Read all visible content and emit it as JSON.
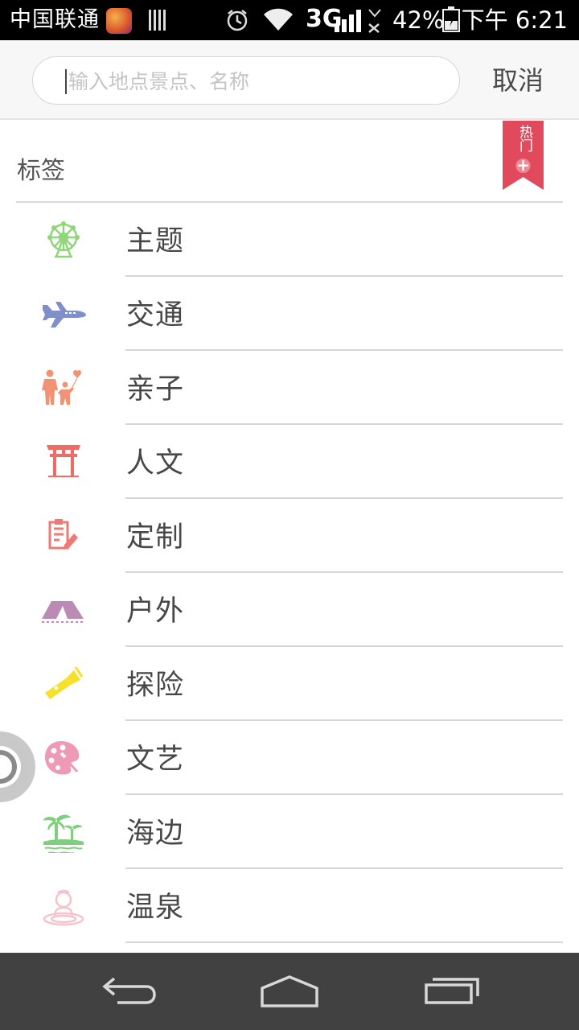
{
  "status_bar": {
    "carrier": "中国联通",
    "network": "3G",
    "battery_percent": "42%",
    "time": "下午 6:21"
  },
  "search": {
    "placeholder": "输入地点景点、名称",
    "value": "",
    "cancel_label": "取消"
  },
  "tags": {
    "title": "标签",
    "hot_ribbon": {
      "text": "热门",
      "plus": "+"
    },
    "items": [
      {
        "label": "主题",
        "icon": "ferris-wheel-icon",
        "color": "#8fd67a"
      },
      {
        "label": "交通",
        "icon": "airplane-icon",
        "color": "#7f8fc9"
      },
      {
        "label": "亲子",
        "icon": "parent-child-icon",
        "color": "#f19274"
      },
      {
        "label": "人文",
        "icon": "torii-gate-icon",
        "color": "#ee6b66"
      },
      {
        "label": "定制",
        "icon": "clipboard-edit-icon",
        "color": "#ef7a74"
      },
      {
        "label": "户外",
        "icon": "tent-icon",
        "color": "#b98bb5"
      },
      {
        "label": "探险",
        "icon": "flashlight-icon",
        "color": "#f6e12a"
      },
      {
        "label": "文艺",
        "icon": "palette-icon",
        "color": "#ee9ab6"
      },
      {
        "label": "海边",
        "icon": "palm-beach-icon",
        "color": "#7ed07d"
      },
      {
        "label": "温泉",
        "icon": "hot-spring-icon",
        "color": "#f4c3cc"
      }
    ]
  },
  "colors": {
    "ribbon": "#e04a5c",
    "nav_bar": "#414141",
    "header_bg": "#f7f7f7"
  }
}
